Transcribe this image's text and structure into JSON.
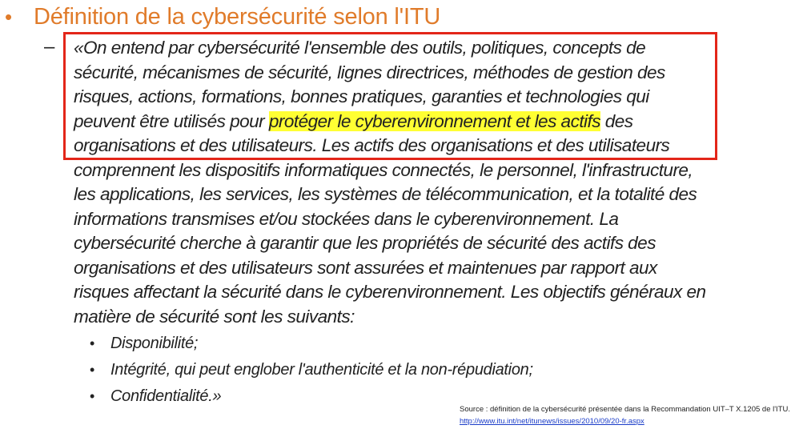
{
  "slide": {
    "title_bullet": "•",
    "title": "Définition de la cybersécurité selon l'ITU",
    "dash": "–",
    "quote_lines": {
      "l1": "«On entend par cybersécurité l'ensemble des outils, politiques, concepts de",
      "l2": "sécurité, mécanismes de sécurité, lignes directrices, méthodes de gestion des",
      "l3": "risques, actions, formations, bonnes pratiques, garanties et technologies qui",
      "l4_before": "peuvent être utilisés pour ",
      "l4_highlight": "protéger le cyberenvironnement et les actifs",
      "l4_after": " des",
      "l5": "organisations et des utilisateurs. Les actifs des organisations et des utilisateurs",
      "l6": "comprennent les dispositifs informatiques connectés, le personnel, l'infrastructure,",
      "l7": "les applications, les services, les systèmes de télécommunication, et la totalité des",
      "l8": "informations transmises et/ou stockées dans le cyberenvironnement. La",
      "l9": "cybersécurité cherche à garantir que les propriétés de sécurité des actifs des",
      "l10": "organisations et des utilisateurs sont assurées et maintenues par rapport aux",
      "l11": "risques affectant la sécurité dans le cyberenvironnement. Les objectifs généraux en",
      "l12": "matière de sécurité sont les suivants:"
    },
    "objectives": [
      {
        "bullet": "•",
        "text": "Disponibilité;"
      },
      {
        "bullet": "•",
        "text": "Intégrité, qui peut englober l'authenticité et la non-répudiation;"
      },
      {
        "bullet": "•",
        "text": "Confidentialité.»"
      }
    ],
    "source": {
      "text": "Source : définition de la cybersécurité présentée dans la Recommandation UIT–T X.1205 de l'ITU.",
      "link": "http://www.itu.int/net/itunews/issues/2010/09/20-fr.aspx"
    }
  },
  "colors": {
    "title": "#e07b2a",
    "highlight": "#ffff33",
    "box_border": "#e32619",
    "link": "#1a3cc8",
    "text": "#222222"
  }
}
